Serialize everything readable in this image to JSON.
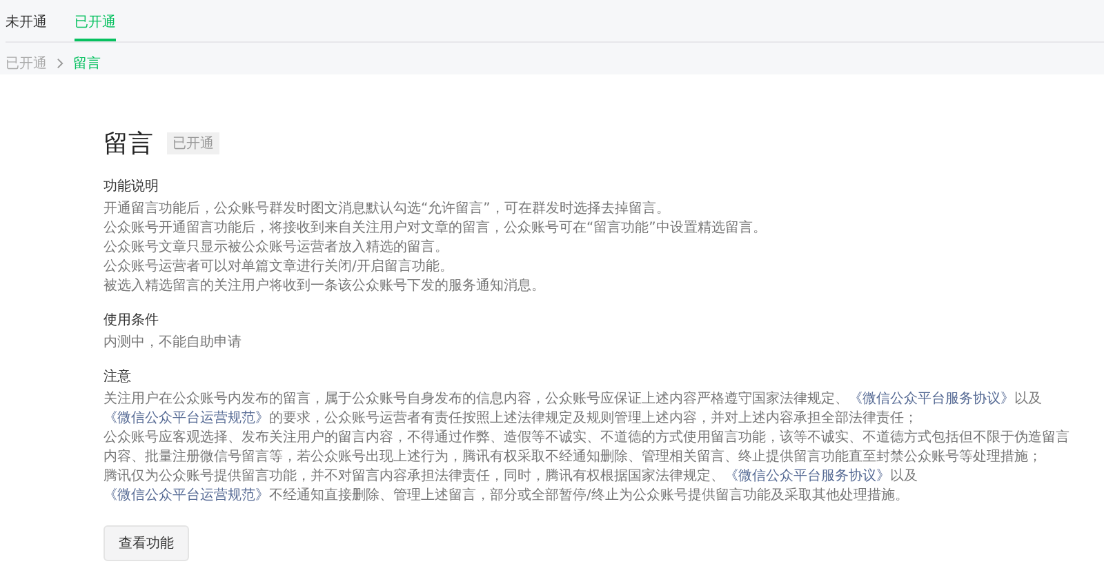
{
  "tabs": [
    {
      "label": "未开通",
      "selected": false
    },
    {
      "label": "已开通",
      "selected": true
    }
  ],
  "breadcrumb": [
    {
      "label": "已开通",
      "current": false
    },
    {
      "label": "留言",
      "current": true
    }
  ],
  "page_title": "留言",
  "status_badge": "已开通",
  "sections": [
    {
      "heading": "功能说明",
      "paragraphs": [
        [
          {
            "kind": "text",
            "text": "开通留言功能后，公众账号群发时图文消息默认勾选“允许留言”，可在群发时选择去掉留言。"
          }
        ],
        [
          {
            "kind": "text",
            "text": "公众账号开通留言功能后，将接收到来自关注用户对文章的留言，公众账号可在“留言功能”中设置精选留言。"
          }
        ],
        [
          {
            "kind": "text",
            "text": "公众账号文章只显示被公众账号运营者放入精选的留言。"
          }
        ],
        [
          {
            "kind": "text",
            "text": "公众账号运营者可以对单篇文章进行关闭/开启留言功能。"
          }
        ],
        [
          {
            "kind": "text",
            "text": "被选入精选留言的关注用户将收到一条该公众账号下发的服务通知消息。"
          }
        ]
      ]
    },
    {
      "heading": "使用条件",
      "paragraphs": [
        [
          {
            "kind": "text",
            "text": "内测中，不能自助申请"
          }
        ]
      ]
    },
    {
      "heading": "注意",
      "paragraphs": [
        [
          {
            "kind": "text",
            "text": "关注用户在公众账号内发布的留言，属于公众账号自身发布的信息内容，公众账号应保证上述内容严格遵守国家法律规定、"
          },
          {
            "kind": "link",
            "text": "《微信公众平台服务协议》"
          },
          {
            "kind": "text",
            "text": "以及"
          },
          {
            "kind": "link",
            "text": "《微信公众平台运营规范》"
          },
          {
            "kind": "text",
            "text": "的要求，公众账号运营者有责任按照上述法律规定及规则管理上述内容，并对上述内容承担全部法律责任；"
          }
        ],
        [
          {
            "kind": "text",
            "text": "公众账号应客观选择、发布关注用户的留言内容，不得通过作弊、造假等不诚实、不道德的方式使用留言功能，该等不诚实、不道德方式包括但不限于伪造留言内容、批量注册微信号留言等，若公众账号出现上述行为，腾讯有权采取不经通知删除、管理相关留言、终止提供留言功能直至封禁公众账号等处理措施；"
          }
        ],
        [
          {
            "kind": "text",
            "text": "腾讯仅为公众账号提供留言功能，并不对留言内容承担法律责任，同时，腾讯有权根据国家法律规定、"
          },
          {
            "kind": "link",
            "text": "《微信公众平台服务协议》"
          },
          {
            "kind": "text",
            "text": "以及"
          },
          {
            "kind": "link",
            "text": "《微信公众平台运营规范》"
          },
          {
            "kind": "text",
            "text": "不经通知直接删除、管理上述留言，部分或全部暂停/终止为公众账号提供留言功能及采取其他处理措施。"
          }
        ]
      ]
    }
  ],
  "action_button": "查看功能"
}
